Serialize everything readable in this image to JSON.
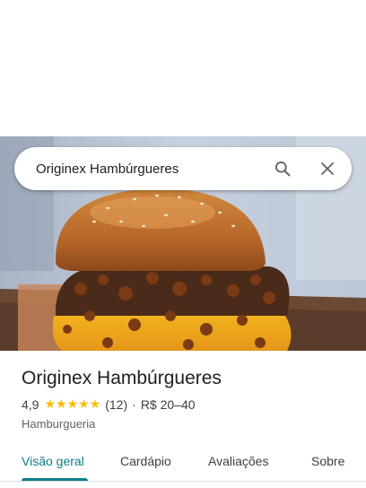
{
  "search": {
    "query": "Originex Hambúrgueres"
  },
  "place": {
    "name": "Originex Hambúrgueres",
    "rating": "4,9",
    "stars": "★★★★★",
    "review_count": "(12)",
    "separator": "·",
    "price_range": "R$ 20–40",
    "category": "Hamburgueria"
  },
  "tabs": [
    {
      "label": "Visão geral",
      "active": true
    },
    {
      "label": "Cardápio",
      "active": false
    },
    {
      "label": "Avaliações",
      "active": false
    },
    {
      "label": "Sobre",
      "active": false
    }
  ],
  "colors": {
    "accent": "#0b7d8a",
    "star": "#fbbc04"
  },
  "icons": [
    "search-icon",
    "close-icon"
  ]
}
